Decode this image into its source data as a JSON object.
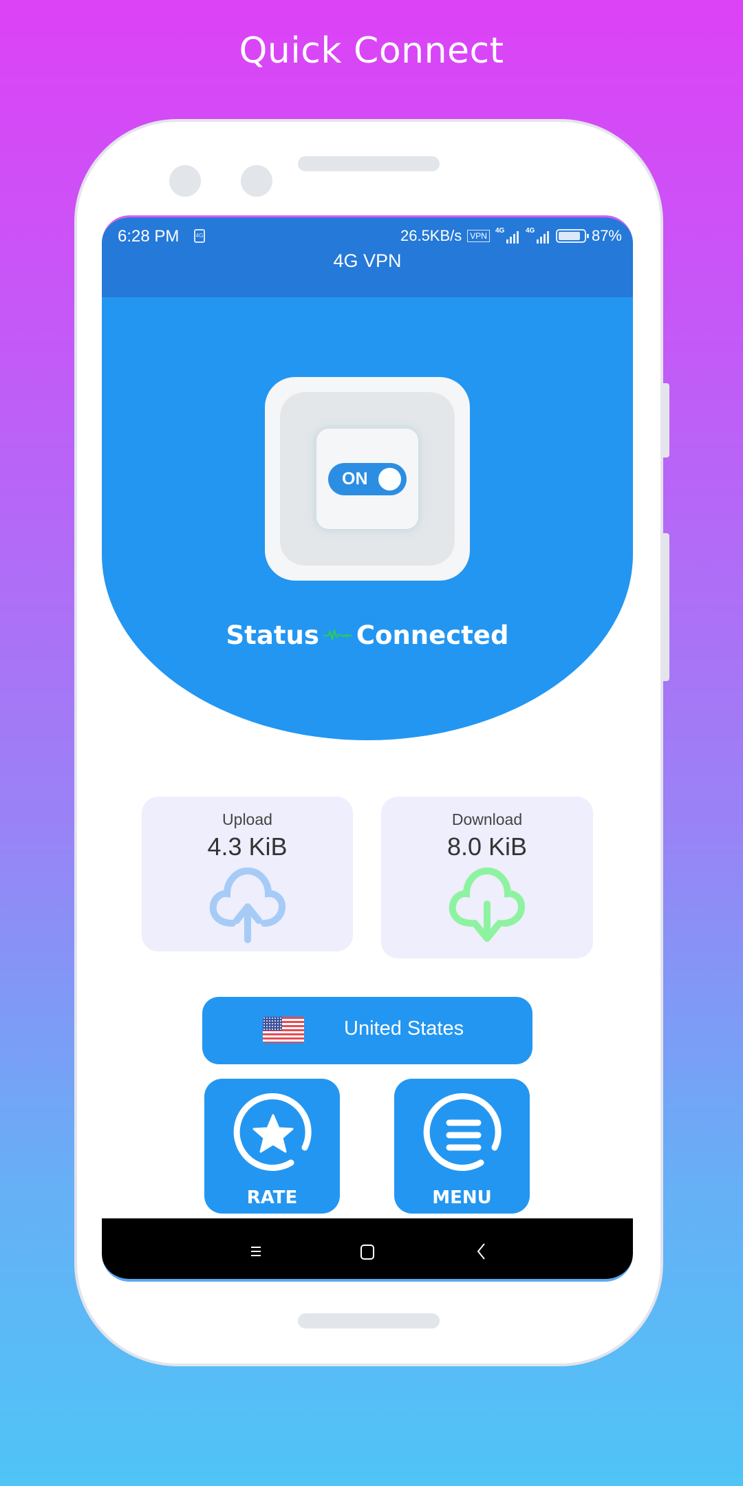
{
  "page": {
    "title": "Quick Connect"
  },
  "status_bar": {
    "time": "6:28 PM",
    "shield_badge": "4G",
    "net_speed": "26.5KB/s",
    "vpn_badge": "VPN",
    "sim1_type": "4G",
    "sim2_type": "4G",
    "battery_level": 0.87,
    "battery_text": "87%"
  },
  "app": {
    "title": "4G VPN"
  },
  "connection": {
    "switch_label": "ON",
    "switch_on": true,
    "status_label": "Status",
    "status_value": "Connected",
    "pulse_color": "#28c66e"
  },
  "stats": {
    "upload": {
      "label": "Upload",
      "value": "4.3 KiB",
      "icon": "cloud-upload-icon",
      "color": "#a6cbf6"
    },
    "download": {
      "label": "Download",
      "value": "8.0 KiB",
      "icon": "cloud-download-icon",
      "color": "#8ef3a0"
    }
  },
  "server": {
    "country": "United States",
    "flag": "us-flag-icon"
  },
  "actions": {
    "rate_label": "RATE",
    "menu_label": "MENU"
  },
  "nav": {
    "recent": "recent-apps",
    "home": "home",
    "back": "back"
  },
  "colors": {
    "primary": "#2396f1",
    "appbar": "#2579d8"
  }
}
